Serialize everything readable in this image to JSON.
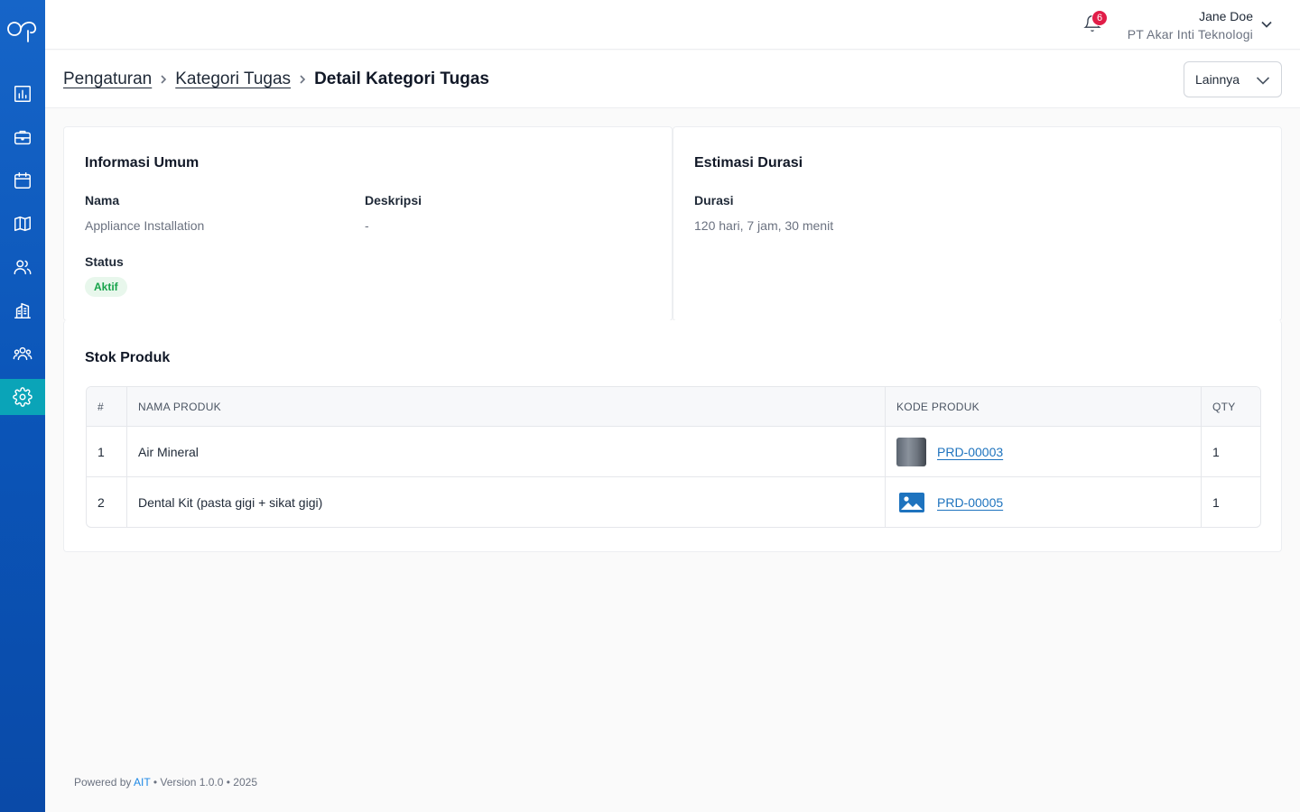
{
  "header": {
    "notification_count": "6",
    "user_name": "Jane Doe",
    "user_company": "PT Akar Inti Teknologi"
  },
  "sidebar": {
    "items": [
      {
        "name": "dashboard",
        "icon": "chart-icon"
      },
      {
        "name": "briefcase",
        "icon": "briefcase-icon"
      },
      {
        "name": "calendar",
        "icon": "calendar-icon"
      },
      {
        "name": "map",
        "icon": "map-icon"
      },
      {
        "name": "users",
        "icon": "users-icon"
      },
      {
        "name": "building",
        "icon": "building-icon"
      },
      {
        "name": "team",
        "icon": "team-icon"
      },
      {
        "name": "settings",
        "icon": "gear-icon",
        "active": true
      }
    ]
  },
  "breadcrumb": {
    "items": [
      "Pengaturan",
      "Kategori Tugas"
    ],
    "current": "Detail Kategori Tugas"
  },
  "actions": {
    "more_label": "Lainnya"
  },
  "general_info": {
    "title": "Informasi Umum",
    "name_label": "Nama",
    "name_value": "Appliance Installation",
    "description_label": "Deskripsi",
    "description_value": "-",
    "status_label": "Status",
    "status_value": "Aktif"
  },
  "duration": {
    "title": "Estimasi Durasi",
    "label": "Durasi",
    "value": "120 hari, 7 jam, 30 menit"
  },
  "stock": {
    "title": "Stok Produk",
    "columns": [
      "#",
      "NAMA PRODUK",
      "KODE PRODUK",
      "QTY"
    ],
    "rows": [
      {
        "no": "1",
        "name": "Air Mineral",
        "code": "PRD-00003",
        "qty": "1",
        "thumb": "photo"
      },
      {
        "no": "2",
        "name": "Dental Kit (pasta gigi + sikat gigi)",
        "code": "PRD-00005",
        "qty": "1",
        "thumb": "image-placeholder-icon"
      }
    ]
  },
  "footer": {
    "powered_prefix": "Powered by",
    "brand": "AIT",
    "version_text": "• Version 1.0.0 • 2025"
  },
  "colors": {
    "sidebar": "#0b55b8",
    "active_nav": "#0aa4b8",
    "link": "#1e73be",
    "badge_bg": "#e8f7ec",
    "badge_text": "#16a34a",
    "notification": "#e11d48"
  }
}
